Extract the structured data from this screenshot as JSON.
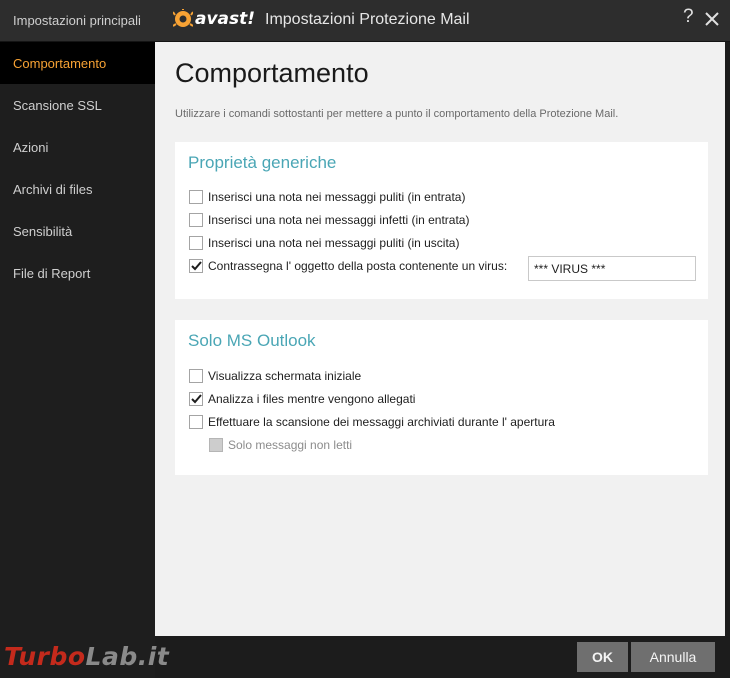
{
  "sidebar": {
    "top_label": "Impostazioni principali",
    "items": [
      {
        "label": "Comportamento"
      },
      {
        "label": "Scansione SSL"
      },
      {
        "label": "Azioni"
      },
      {
        "label": "Archivi di files"
      },
      {
        "label": "Sensibilità"
      },
      {
        "label": "File di Report"
      }
    ]
  },
  "titlebar": {
    "brand": "avast!",
    "title": "Impostazioni Protezione Mail",
    "help": "?"
  },
  "page": {
    "title": "Comportamento",
    "description": "Utilizzare i comandi sottostanti per mettere a punto il comportamento della Protezione Mail."
  },
  "panel_generic": {
    "title": "Proprietà generiche",
    "options": [
      {
        "label": "Inserisci una nota nei messaggi puliti (in entrata)",
        "checked": false
      },
      {
        "label": "Inserisci una nota nei messaggi infetti (in entrata)",
        "checked": false
      },
      {
        "label": "Inserisci una nota nei messaggi puliti (in uscita)",
        "checked": false
      },
      {
        "label": "Contrassegna l' oggetto della posta contenente un virus:",
        "checked": true
      }
    ],
    "subject_tag": "*** VIRUS ***"
  },
  "panel_outlook": {
    "title": "Solo MS Outlook",
    "options": [
      {
        "label": "Visualizza schermata iniziale",
        "checked": false
      },
      {
        "label": "Analizza i files mentre vengono allegati",
        "checked": true
      },
      {
        "label": "Effettuare la scansione dei messaggi archiviati durante l' apertura",
        "checked": false
      },
      {
        "label": "Solo messaggi non letti",
        "checked": false,
        "disabled": true
      }
    ]
  },
  "footer": {
    "ok_label": "OK",
    "cancel_label": "Annulla"
  },
  "watermark": {
    "part1": "Turbo",
    "part2": "Lab.it"
  },
  "colors": {
    "accent_orange": "#f7a234",
    "section_teal": "#4aa6b5",
    "button_gray": "#6f6f6f"
  }
}
